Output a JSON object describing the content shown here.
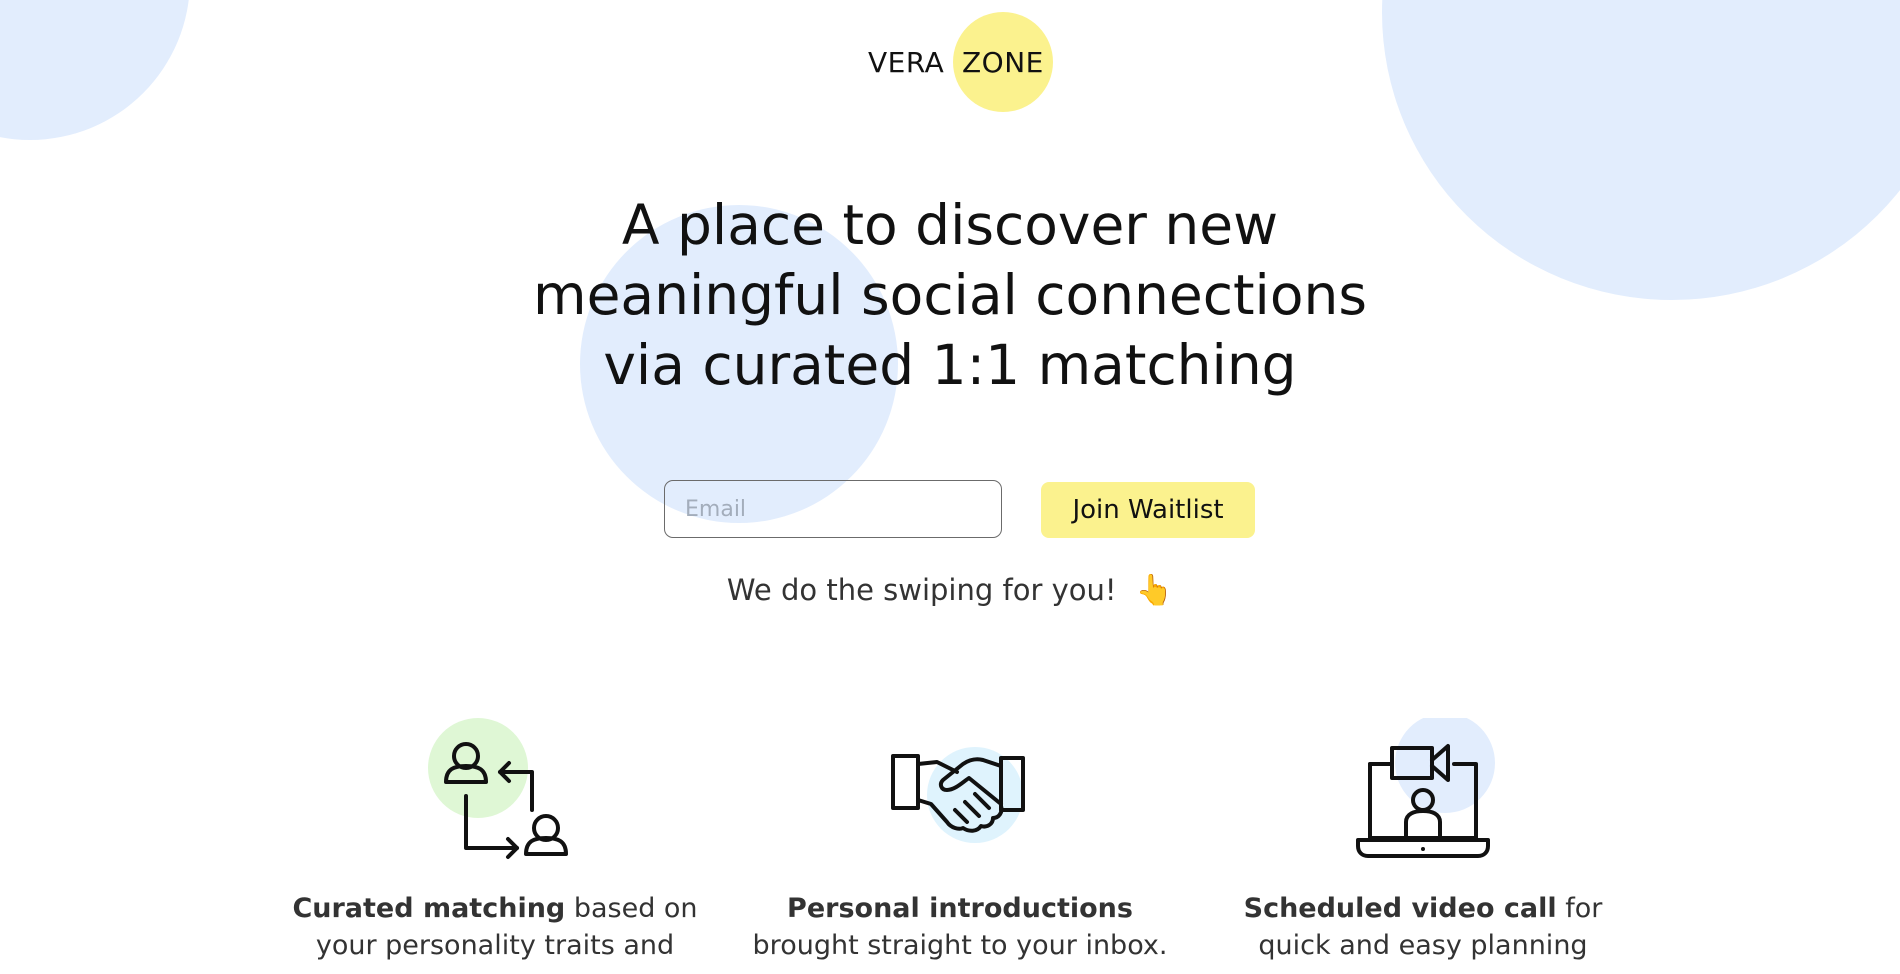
{
  "brand": {
    "left": "VERA",
    "right": "ZONE",
    "accent_color": "#fbf28e"
  },
  "hero": {
    "headline_lines": [
      "A place to discover new",
      "meaningful social connections",
      "via curated 1:1 matching"
    ]
  },
  "signup": {
    "email_placeholder": "Email",
    "email_value": "",
    "button_label": "Join Waitlist"
  },
  "tagline": {
    "text": "We do the swiping for you!",
    "emoji": "👆"
  },
  "features": [
    {
      "icon": "user-matching-icon",
      "bold": "Curated matching",
      "line1_rest": " based on",
      "line2": "your personality traits and"
    },
    {
      "icon": "handshake-icon",
      "bold": "Personal introductions",
      "line1_rest": "",
      "line2": "brought straight to your inbox."
    },
    {
      "icon": "video-call-icon",
      "bold": "Scheduled video call",
      "line1_rest": " for",
      "line2": "quick and easy planning"
    }
  ],
  "colors": {
    "background_circle": "#e2edfd",
    "matching_icon_accent": "#dff7d5",
    "handshake_icon_accent": "#dff3fd",
    "video_icon_accent": "#e2edfd"
  }
}
